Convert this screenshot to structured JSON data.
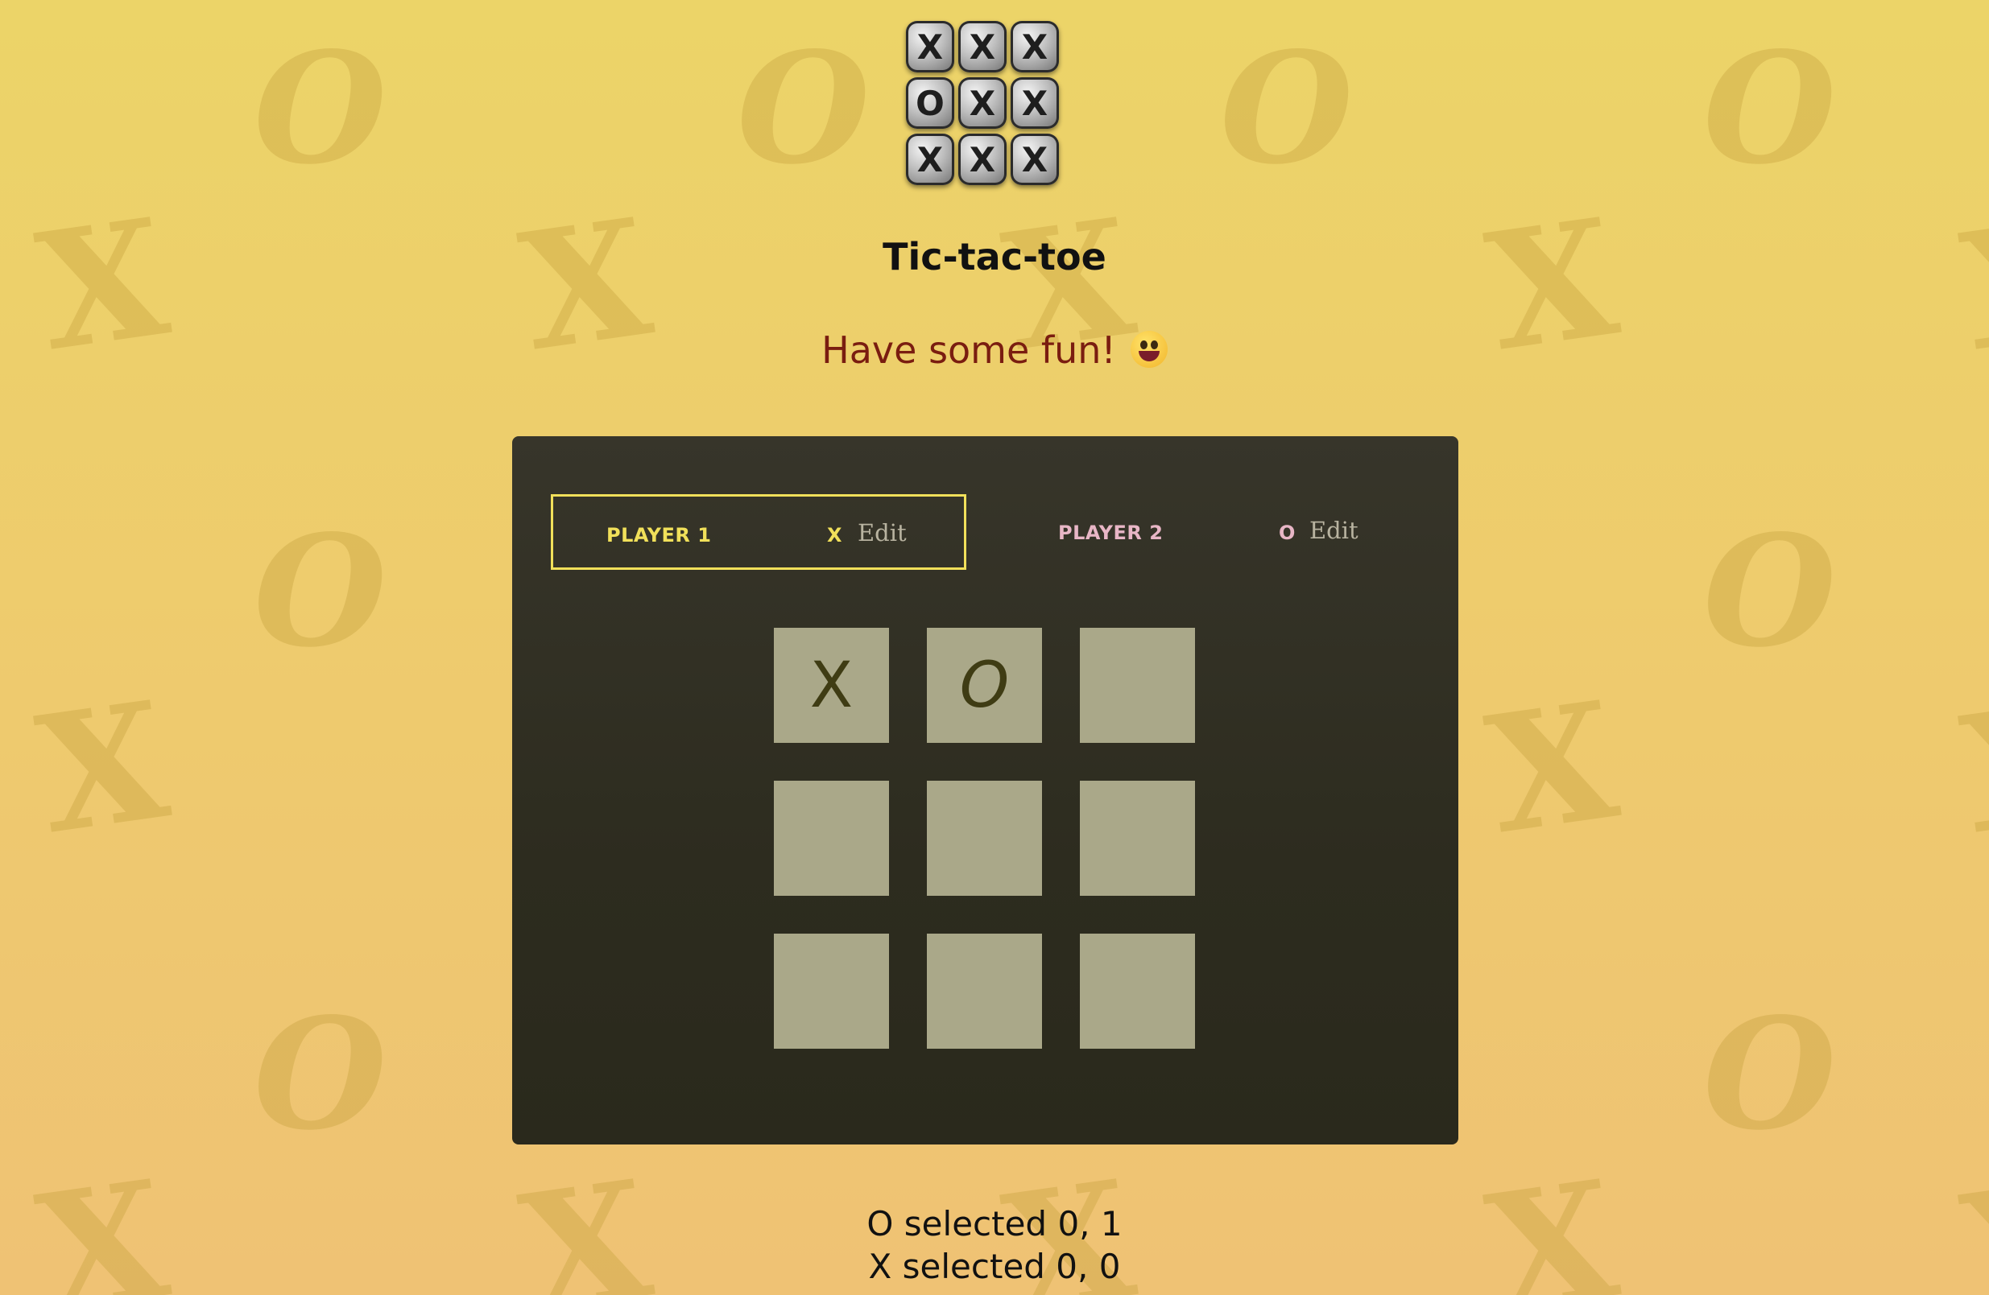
{
  "app": {
    "title": "Tic-tac-toe",
    "subtitle": "Have some fun!",
    "subtitle_emoji": "grinning-face-emoji"
  },
  "logo": {
    "tiles": [
      "X",
      "X",
      "X",
      "O",
      "X",
      "X",
      "X",
      "X",
      "X"
    ]
  },
  "players": [
    {
      "name": "PLAYER 1",
      "symbol": "X",
      "edit_label": "Edit",
      "active": true,
      "color": "#f1e05a"
    },
    {
      "name": "PLAYER 2",
      "symbol": "O",
      "edit_label": "Edit",
      "active": false,
      "color": "#e8b6c6"
    }
  ],
  "board": {
    "cells": [
      [
        "X",
        "O",
        ""
      ],
      [
        "",
        "",
        ""
      ],
      [
        "",
        "",
        ""
      ]
    ]
  },
  "log": [
    "O selected 0, 1",
    "X selected 0, 0"
  ],
  "colors": {
    "background_top": "#ecd468",
    "background_bottom": "#efc274",
    "panel": "#2d2c1f",
    "cell": "#aaa889",
    "mark": "#3f3c14",
    "subtitle": "#7a1d10",
    "active_border": "#f1e05a"
  }
}
